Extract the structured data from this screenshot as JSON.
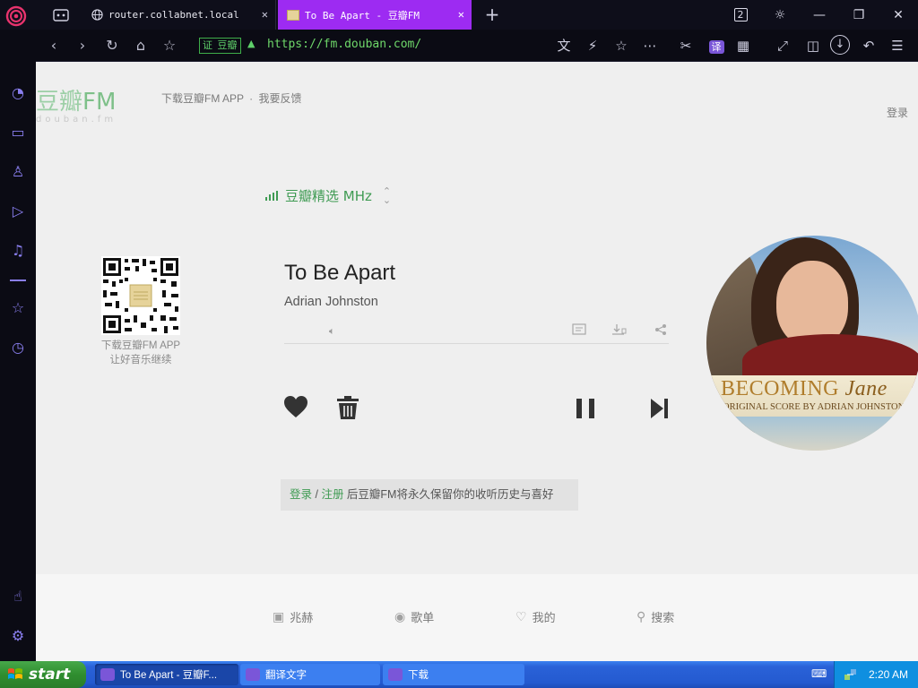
{
  "browser": {
    "tabs": [
      {
        "title": "router.collabnet.local"
      },
      {
        "title": "To Be Apart - 豆瓣FM"
      }
    ],
    "new_tab_symbol": "+",
    "tab_count_badge": "2",
    "url": "https://fm.douban.com/",
    "cert_badge": "证",
    "cert_label": "豆瓣",
    "translate_badge": "译",
    "colors": {
      "active_tab": "#9d2bf2",
      "url": "#6fd86a",
      "sidebar_icon": "#8a7ff0"
    }
  },
  "page": {
    "logo_main": "豆瓣",
    "logo_fm": "FM",
    "logo_sub": "douban.fm",
    "top_link_app": "下载豆瓣FM APP",
    "top_link_sep": "·",
    "top_link_feedback": "我要反馈",
    "login": "登录",
    "channel": "豆瓣精选 MHz",
    "qr_line1": "下载豆瓣FM APP",
    "qr_line2": "让好音乐继续",
    "song": {
      "title": "To Be Apart",
      "artist": "Adrian Johnston"
    },
    "cover": {
      "title_main": "BECOMING",
      "title_script": "Jane",
      "subtitle": "ORIGINAL SCORE BY ADRIAN JOHNSTON"
    },
    "login_banner": {
      "login": "登录",
      "sep": " / ",
      "register": "注册",
      "text": " 后豆瓣FM将永久保留你的收听历史与喜好"
    },
    "bottom_nav": [
      {
        "label": "兆赫",
        "icon": "radio-icon"
      },
      {
        "label": "歌单",
        "icon": "disc-icon"
      },
      {
        "label": "我的",
        "icon": "heart-icon"
      },
      {
        "label": "搜索",
        "icon": "search-icon"
      }
    ],
    "colors": {
      "accent_green": "#3f9b53",
      "background": "#efefef"
    }
  },
  "taskbar": {
    "start": "start",
    "tasks": [
      {
        "label": "To Be Apart - 豆瓣F..."
      },
      {
        "label": "翻译文字"
      },
      {
        "label": "下载"
      }
    ],
    "clock": "2:20 AM"
  }
}
